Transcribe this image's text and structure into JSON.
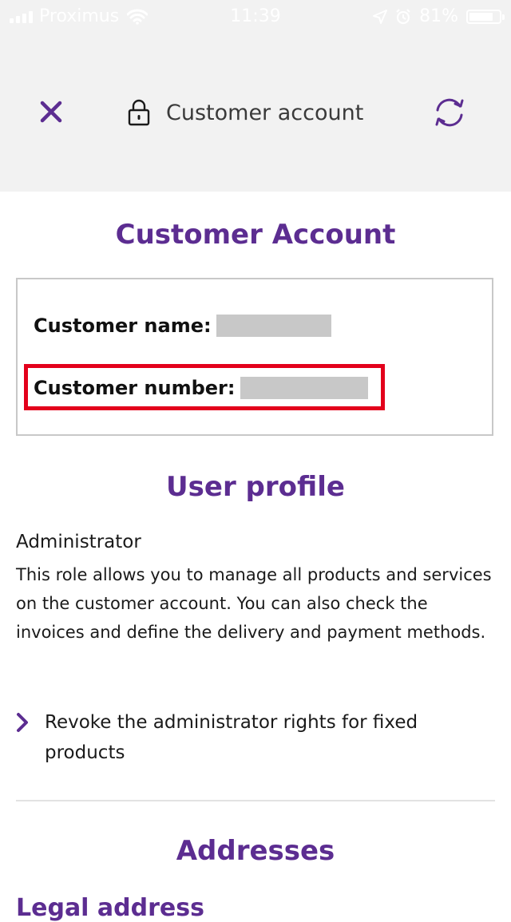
{
  "status_bar": {
    "carrier": "Proximus",
    "time": "11:39",
    "battery": "81%",
    "battery_level": 0.81
  },
  "nav": {
    "close_icon": "close-x-icon",
    "lock_icon": "lock-icon",
    "title": "Customer account",
    "refresh_icon": "refresh-icon"
  },
  "customer_account": {
    "heading": "Customer Account",
    "name_label": "Customer name:",
    "number_label": "Customer number:"
  },
  "user_profile": {
    "heading": "User profile",
    "role": "Administrator",
    "description": "This role allows you to manage all products and services on the customer account. You can also check the invoices and define the delivery and payment methods.",
    "revoke_link": "Revoke the administrator rights for fixed products"
  },
  "addresses": {
    "heading": "Addresses",
    "legal_address_heading": "Legal address"
  },
  "colors": {
    "brand_purple": "#5c2d91",
    "highlight_red": "#e3001b",
    "header_gray": "#f2f2f2"
  }
}
